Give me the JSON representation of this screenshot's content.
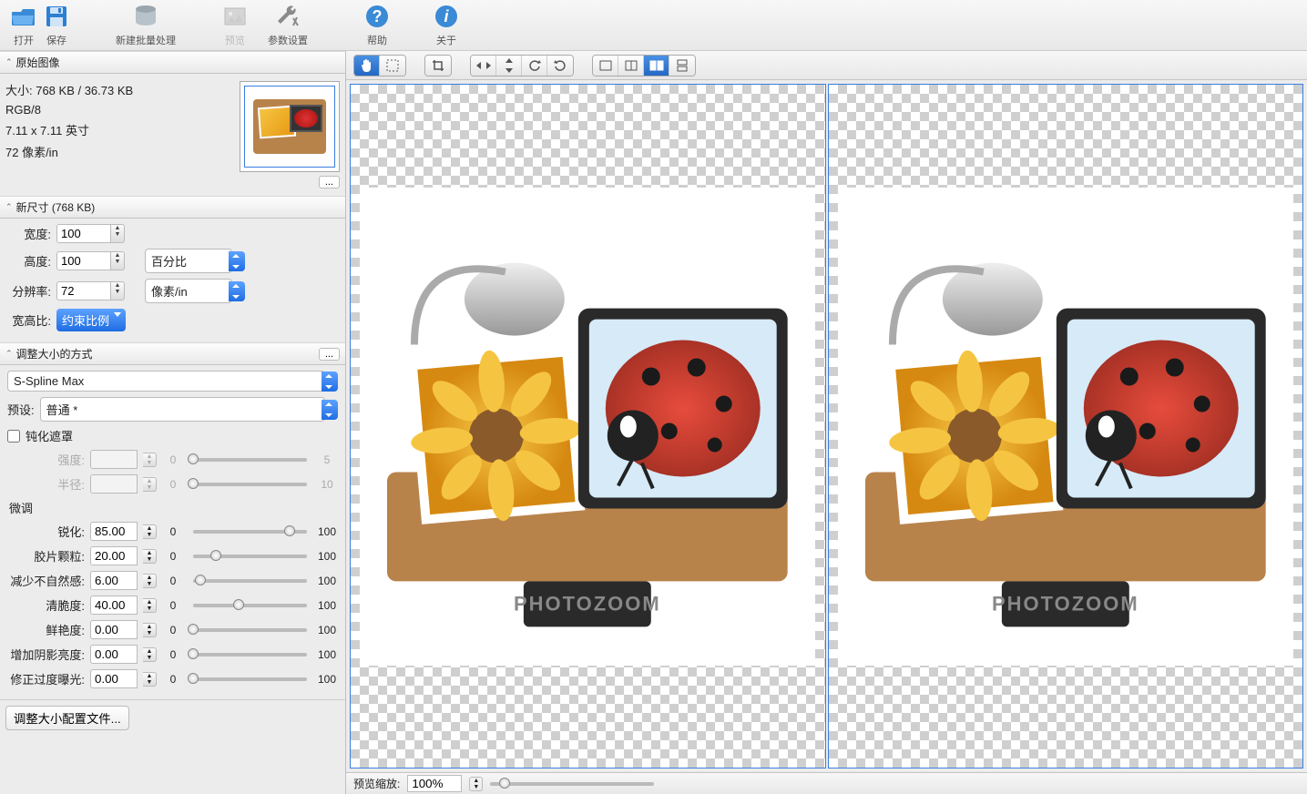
{
  "toolbar": {
    "open": "打开",
    "save": "保存",
    "new_batch": "新建批量处理",
    "preview": "预览",
    "preferences": "参数设置",
    "help": "帮助",
    "about": "关于"
  },
  "original": {
    "header": "原始图像",
    "size": "大小: 768 KB / 36.73 KB",
    "mode": "RGB/8",
    "dimensions": "7.11 x 7.11 英寸",
    "resolution": "72 像素/in",
    "more": "..."
  },
  "newsize": {
    "header": "新尺寸 (768 KB)",
    "width_label": "宽度:",
    "width_value": "100",
    "height_label": "高度:",
    "height_value": "100",
    "unit": "百分比",
    "res_label": "分辨率:",
    "res_value": "72",
    "res_unit": "像素/in",
    "aspect_label": "宽高比:",
    "aspect_value": "约束比例"
  },
  "method": {
    "header": "调整大小的方式",
    "algorithm": "S-Spline Max",
    "preset_label": "预设:",
    "preset_value": "普通 *",
    "unsharp_label": "钝化遮罩",
    "strength_label": "强度:",
    "strength_value": "",
    "radius_label": "半径:",
    "radius_value": "",
    "finetune_label": "微调",
    "sharpen_label": "锐化:",
    "sharpen_value": "85.00",
    "grain_label": "胶片颗粒:",
    "grain_value": "20.00",
    "reduce_label": "减少不自然感:",
    "reduce_value": "6.00",
    "crisp_label": "清脆度:",
    "crisp_value": "40.00",
    "vivid_label": "鲜艳度:",
    "vivid_value": "0.00",
    "shadow_label": "增加阴影亮度:",
    "shadow_value": "0.00",
    "exposure_label": "修正过度曝光:",
    "exposure_value": "0.00",
    "min_disabled": "0",
    "max5": "5",
    "max10": "10",
    "min": "0",
    "max": "100",
    "more": "..."
  },
  "resize_config": {
    "button": "调整大小配置文件..."
  },
  "bottom": {
    "zoom_label": "预览缩放:",
    "zoom_value": "100%"
  }
}
